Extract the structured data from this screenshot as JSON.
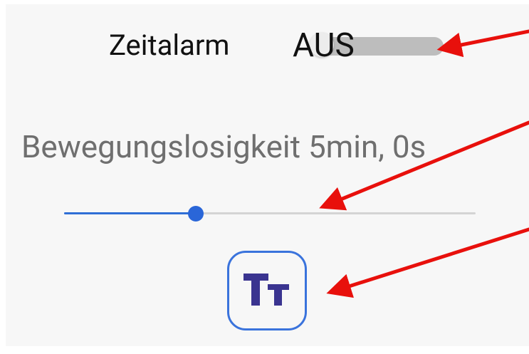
{
  "zeitalarm": {
    "label": "Zeitalarm",
    "toggle_state": "AUS",
    "checked": false
  },
  "inactivity": {
    "label": "Bewegungslosigkeit 5min, 0s",
    "slider_fraction": 0.32
  },
  "text_size_button": {
    "icon": "text-size-icon"
  },
  "annotations": {
    "arrow_color": "#e8100c"
  },
  "colors": {
    "accent": "#2a66d8",
    "panel_background": "#f7f7f7"
  }
}
